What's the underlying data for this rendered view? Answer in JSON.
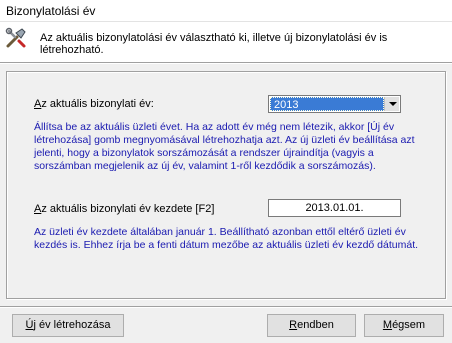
{
  "window": {
    "title": "Bizonylatolási év"
  },
  "header": {
    "icon": "tools-icon",
    "text": "Az aktuális bizonylatolási év választható ki, illetve új bizonylatolási év is létrehozható."
  },
  "year_select": {
    "label_first": "A",
    "label_rest": "z aktuális bizonylati év:",
    "value": "2013",
    "help": "Állítsa be az aktuális üzleti évet. Ha az adott év még nem létezik, akkor [Új év létrehozása] gomb megnyomásával létrehozhatja azt. Az új üzleti év beállítása azt jelenti, hogy a bizonylatok sorszámozását a rendszer újraindítja (vagyis a sorszámban megjelenik az új év, valamint 1-ről kezdődik a sorszámozás)."
  },
  "start_date": {
    "label_first": "A",
    "label_rest": "z aktuális bizonylati év kezdete [F2]",
    "value": "2013.01.01.",
    "help": "Az üzleti év kezdete általában január 1. Beállítható azonban ettől eltérő üzleti év kezdés is. Ehhez írja be a fenti dátum mezőbe az aktuális üzleti év kezdő dátumát."
  },
  "buttons": {
    "new_year_first": "Ú",
    "new_year_rest": "j év létrehozása",
    "ok_first": "R",
    "ok_rest": "endben",
    "cancel_first": "M",
    "cancel_rest": "égsem"
  },
  "colors": {
    "help_text": "#1a1ab0",
    "selection": "#3a7bd5"
  }
}
